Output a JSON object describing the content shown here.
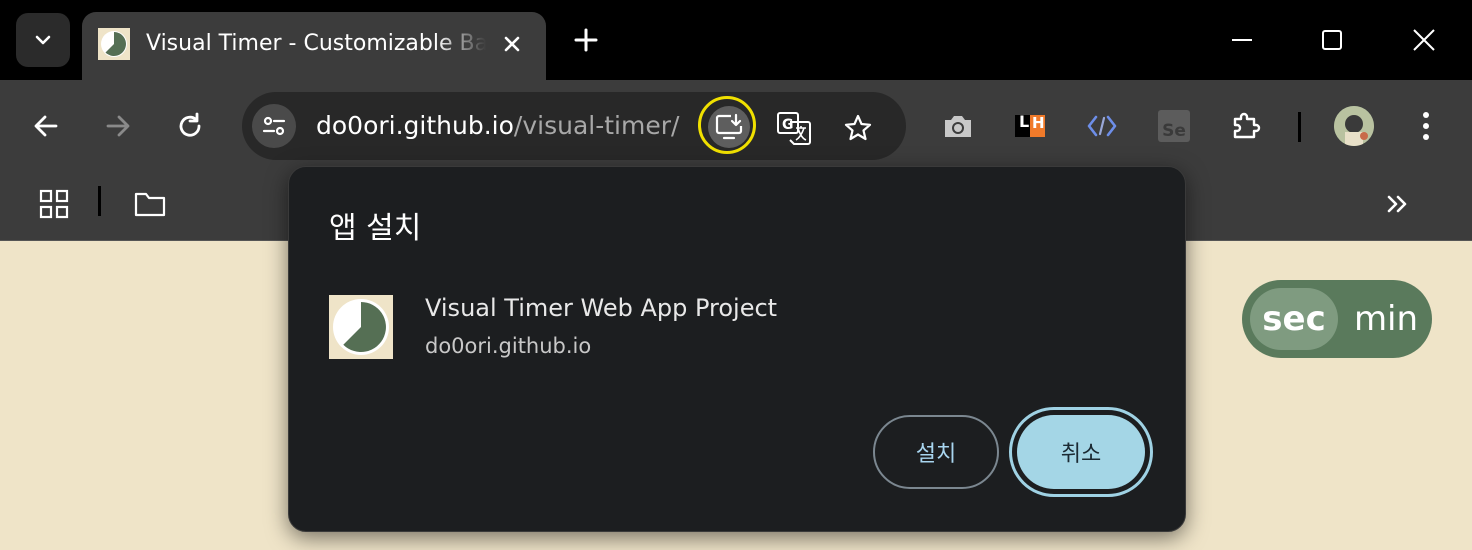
{
  "tab": {
    "title": "Visual Timer - Customizable Basic Timer",
    "close_icon": "close-icon",
    "new_tab_icon": "plus-icon"
  },
  "omnibox": {
    "url_host": "do0ori.github.io",
    "url_path": "/visual-timer/"
  },
  "extensions": {
    "lh_label": "L",
    "lh_label2": "H",
    "se_label": "Se"
  },
  "page": {
    "toggle_sec": "sec",
    "toggle_min": "min"
  },
  "dialog": {
    "title": "앱 설치",
    "app_name": "Visual Timer Web App Project",
    "app_origin": "do0ori.github.io",
    "install_label": "설치",
    "cancel_label": "취소"
  },
  "colors": {
    "page_bg": "#efe4c8",
    "toggle_bg": "#5a7a5c",
    "accent": "#a4d6e6",
    "highlight_ring": "#f0e000"
  }
}
